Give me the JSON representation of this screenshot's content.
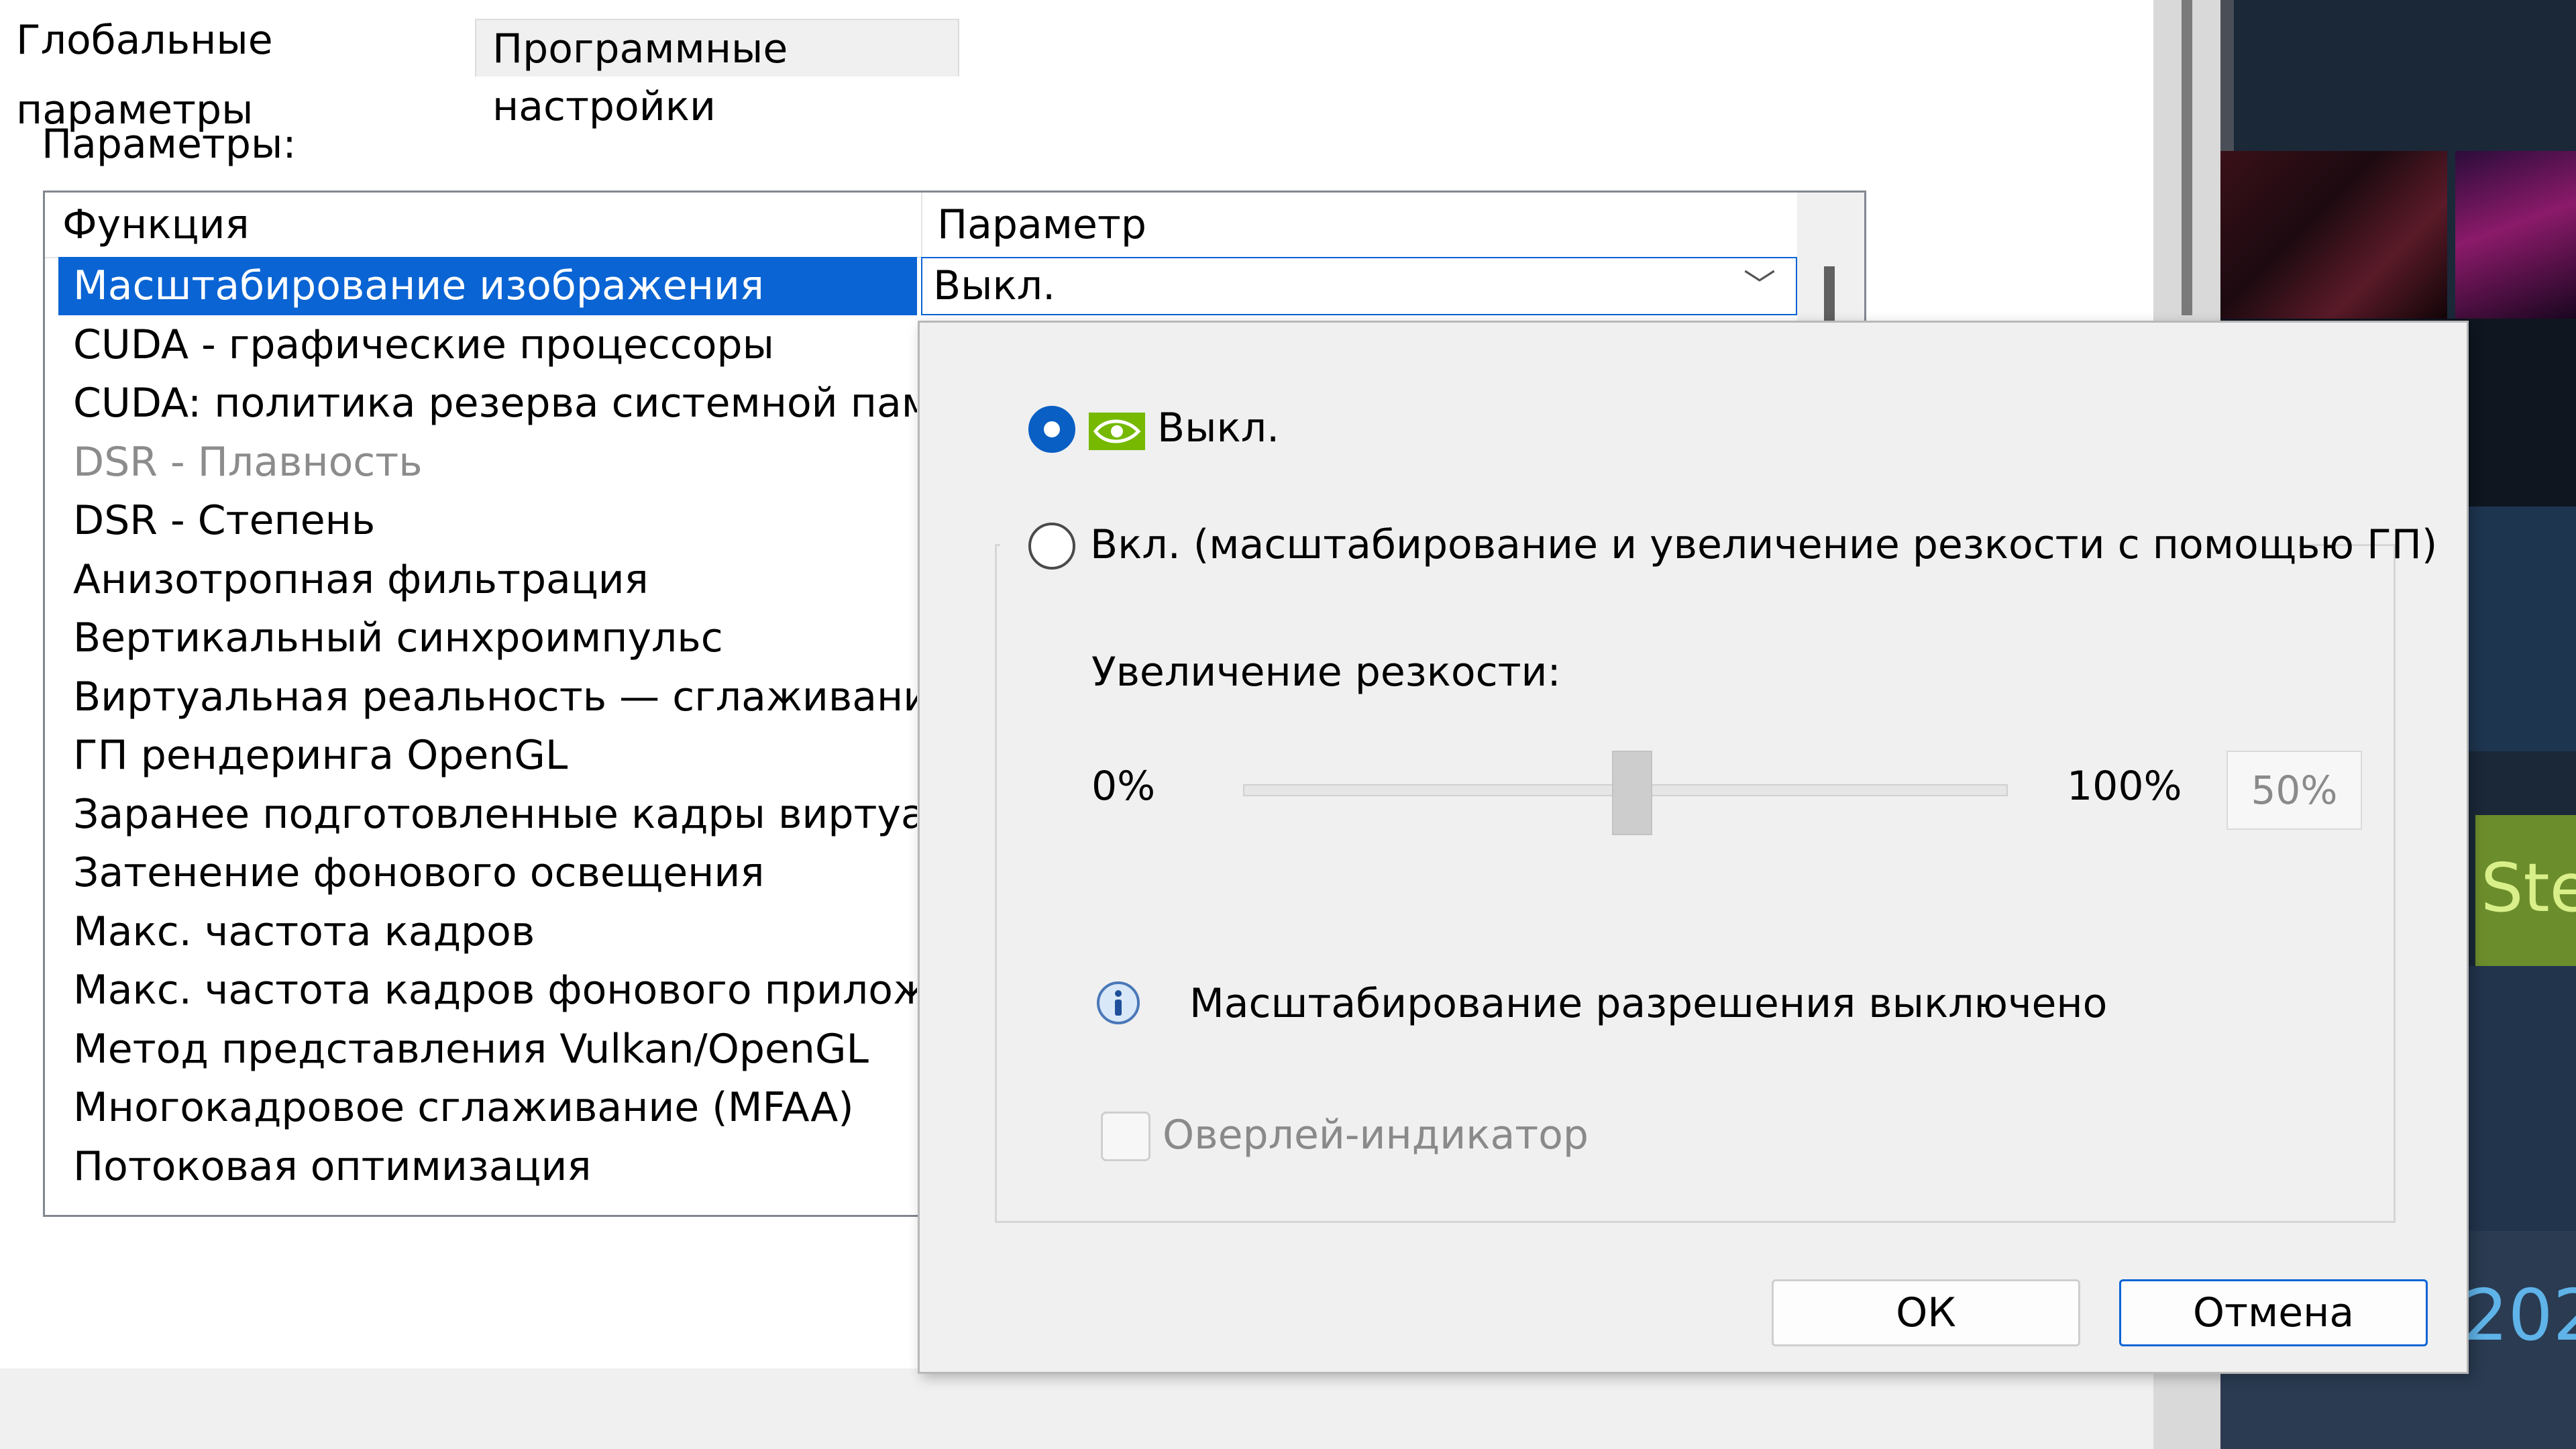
{
  "tabs": {
    "global": "Глобальные параметры",
    "program": "Программные настройки"
  },
  "settings_label": "Параметры:",
  "columns": {
    "function": "Функция",
    "parameter": "Параметр"
  },
  "rows": [
    {
      "label": "Масштабирование изображения",
      "state": "selected"
    },
    {
      "label": "CUDA - графические процессоры",
      "state": "normal"
    },
    {
      "label": "CUDA: политика резерва системной памяти",
      "state": "normal"
    },
    {
      "label": "DSR - Плавность",
      "state": "disabled"
    },
    {
      "label": "DSR - Степень",
      "state": "normal"
    },
    {
      "label": "Анизотропная фильтрация",
      "state": "normal"
    },
    {
      "label": "Вертикальный синхроимпульс",
      "state": "normal"
    },
    {
      "label": "Виртуальная реальность — сглаживание ...",
      "state": "normal"
    },
    {
      "label": "ГП рендеринга OpenGL",
      "state": "normal"
    },
    {
      "label": "Заранее подготовленные кадры виртуаль...",
      "state": "normal"
    },
    {
      "label": "Затенение фонового освещения",
      "state": "normal"
    },
    {
      "label": "Макс. частота кадров",
      "state": "normal"
    },
    {
      "label": "Макс. частота кадров фонового приложе...",
      "state": "normal"
    },
    {
      "label": "Метод представления Vulkan/OpenGL",
      "state": "normal"
    },
    {
      "label": "Многокадровое сглаживание (MFAA)",
      "state": "normal"
    },
    {
      "label": "Потоковая оптимизация",
      "state": "normal"
    }
  ],
  "selected_value": "Выкл.",
  "popup": {
    "option_off": "Выкл.",
    "option_on": "Вкл. (масштабирование и увеличение резкости с помощью ГП)",
    "sharpening_label": "Увеличение резкости:",
    "min_label": "0%",
    "max_label": "100%",
    "value_display": "50%",
    "slider_fraction": 0.5,
    "info_text": "Масштабирование разрешения выключено",
    "overlay_label": "Оверлей-индикатор",
    "overlay_checked": false,
    "ok_label": "ОК",
    "cancel_label": "Отмена"
  },
  "background_app": {
    "green_label": "Ste",
    "year_label": "202"
  },
  "colors": {
    "selection": "#0a64d4",
    "nvidia_green": "#76b900"
  }
}
